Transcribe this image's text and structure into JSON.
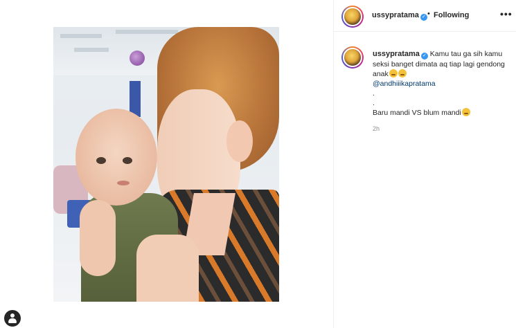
{
  "post": {
    "username": "ussypratama",
    "verified_badge": "verified-icon",
    "separator": "•",
    "follow_status": "Following",
    "more_label": "•••",
    "caption": {
      "text_line1": "Kamu tau ga sih kamu seksi banget dimata aq tiap lagi gendong anak",
      "emoji1": "smirk-emoji",
      "emoji2": "blush-emoji",
      "mention": "@andhiiikapratama",
      "dot1": ".",
      "dot2": ".",
      "line2": "Baru mandi VS blum mandi",
      "emoji3": "grin-emoji",
      "time": "2h"
    }
  },
  "icons": {
    "profile": "user-circle-icon"
  },
  "colors": {
    "verified": "#3897f0",
    "mention": "#00376b",
    "muted": "#8e8e8e",
    "border": "#efefef"
  }
}
